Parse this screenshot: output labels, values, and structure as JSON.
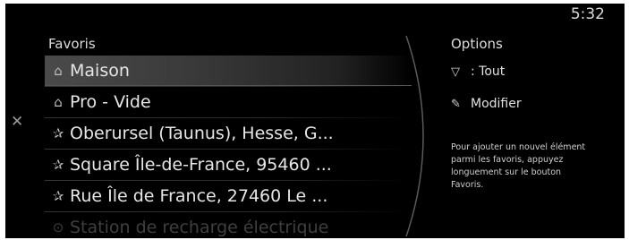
{
  "status": {
    "time": "5:32"
  },
  "nav": {
    "back_icon": "close-icon"
  },
  "favorites": {
    "title": "Favoris",
    "items": [
      {
        "label": "Maison",
        "icon": "home-icon",
        "selected": true
      },
      {
        "label": "Pro - Vide",
        "icon": "briefcase-icon",
        "selected": false
      },
      {
        "label": "Oberursel (Taunus), Hesse, G...",
        "icon": "pin-icon",
        "selected": false
      },
      {
        "label": "Square Île-de-France, 95460 ...",
        "icon": "pin-icon",
        "selected": false
      },
      {
        "label": "Rue Île de France, 27460 Le ...",
        "icon": "pin-icon",
        "selected": false
      },
      {
        "label": "Station de recharge électrique",
        "icon": "location-icon",
        "selected": false,
        "faded": true
      }
    ]
  },
  "options": {
    "title": "Options",
    "filter_label": ": Tout",
    "edit_label": "Modifier",
    "hint": "Pour ajouter un nouvel élément parmi les favoris, appuyez longuement sur le bouton Favoris."
  }
}
